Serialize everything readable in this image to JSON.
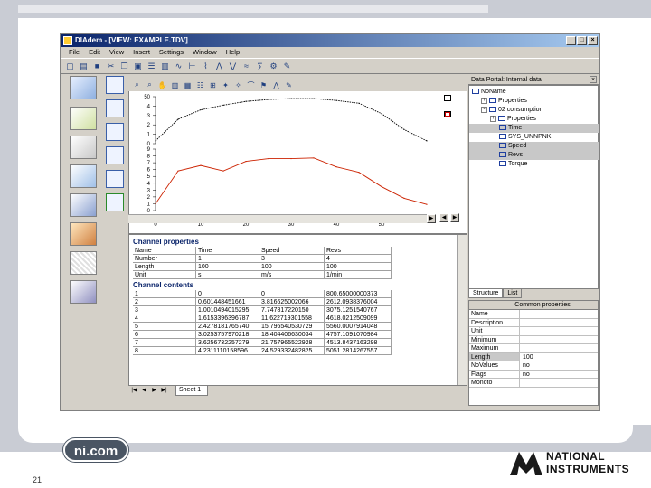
{
  "slide": {
    "logo_text": "ni.com",
    "slide_number": "21",
    "brand_line1": "NATIONAL",
    "brand_line2": "INSTRUMENTS"
  },
  "window": {
    "title": "DIAdem - [VIEW: EXAMPLE.TDV]",
    "menu": [
      "File",
      "Edit",
      "View",
      "Insert",
      "Settings",
      "Window",
      "Help"
    ],
    "min_label": "_",
    "max_label": "□",
    "close_label": "×"
  },
  "chart_data": {
    "type": "line",
    "x": [
      0,
      5,
      10,
      15,
      20,
      25,
      30,
      35,
      40,
      45,
      50,
      55,
      60
    ],
    "xticks": [
      "0",
      "10",
      "20",
      "30",
      "40",
      "50"
    ],
    "xlim": [
      0,
      60
    ],
    "upper": {
      "yticks": [
        "0",
        "1",
        "2",
        "3",
        "4",
        "50"
      ],
      "ylim": [
        0,
        5
      ],
      "series": [
        {
          "color": "#000000",
          "style": "dashed",
          "values": [
            0.3,
            2.6,
            3.6,
            4.1,
            4.5,
            4.7,
            4.8,
            4.8,
            4.6,
            4.3,
            3.2,
            1.5,
            0.3
          ]
        }
      ]
    },
    "lower": {
      "yticks": [
        "0",
        "1",
        "2",
        "3",
        "4",
        "5",
        "6",
        "7",
        "8",
        "9"
      ],
      "ylim": [
        0,
        9
      ],
      "series": [
        {
          "color": "#cc2200",
          "style": "solid",
          "values": [
            1.0,
            5.8,
            6.6,
            5.8,
            7.2,
            7.6,
            7.6,
            7.7,
            6.4,
            5.6,
            3.5,
            1.8,
            0.9
          ]
        }
      ]
    }
  },
  "portal": {
    "title": "Data Portal: Internal data",
    "close_label": "×",
    "tree": [
      {
        "label": "NoName",
        "indent": 0,
        "expander": "",
        "selected": false
      },
      {
        "label": "Properties",
        "indent": 1,
        "expander": "+",
        "selected": false
      },
      {
        "label": "02 consumption",
        "indent": 1,
        "expander": "-",
        "selected": false
      },
      {
        "label": "Properties",
        "indent": 2,
        "expander": "+",
        "selected": false
      },
      {
        "label": "Time",
        "indent": 3,
        "expander": "",
        "selected": true
      },
      {
        "label": "SYS_UNNPNK",
        "indent": 3,
        "expander": "",
        "selected": false
      },
      {
        "label": "Speed",
        "indent": 3,
        "expander": "",
        "selected": true
      },
      {
        "label": "Revs",
        "indent": 3,
        "expander": "",
        "selected": true
      },
      {
        "label": "Torque",
        "indent": 3,
        "expander": "",
        "selected": false
      }
    ],
    "tabs": [
      "Structure",
      "List"
    ],
    "props_header": "Common properties",
    "props": [
      {
        "k": "Name",
        "v": "",
        "sel": false
      },
      {
        "k": "Description",
        "v": "",
        "sel": false
      },
      {
        "k": "Unit",
        "v": "",
        "sel": false
      },
      {
        "k": "Minimum",
        "v": "",
        "sel": false
      },
      {
        "k": "Maximum",
        "v": "",
        "sel": false
      },
      {
        "k": "Length",
        "v": "100",
        "sel": true
      },
      {
        "k": "NoValues",
        "v": "no",
        "sel": false
      },
      {
        "k": "Flags",
        "v": "no",
        "sel": false
      },
      {
        "k": "Monoto",
        "v": "",
        "sel": false
      }
    ]
  },
  "sheet": {
    "section1": "Channel properties",
    "props_rows": [
      [
        "Name",
        "Time",
        "Speed",
        "Revs"
      ],
      [
        "Number",
        "1",
        "3",
        "4"
      ],
      [
        "Length",
        "100",
        "100",
        "100"
      ],
      [
        "Unit",
        "s",
        "m/s",
        "1/min"
      ]
    ],
    "section2": "Channel contents",
    "data_rows": [
      [
        "1",
        "0",
        "0",
        "800.65000000373"
      ],
      [
        "2",
        "0.601448451661",
        "3.816625002066",
        "2612.0938376004"
      ],
      [
        "3",
        "1.0010494015295",
        "7.747817220150",
        "3075.1251540767"
      ],
      [
        "4",
        "1.6153396396787",
        "11.622719301558",
        "4618.0212509099"
      ],
      [
        "5",
        "2.4278181765740",
        "15.796540530729",
        "5560.0007914048"
      ],
      [
        "6",
        "3.0253757970218",
        "18.404406630034",
        "4757.1091070984"
      ],
      [
        "7",
        "3.6256732257279",
        "21.757965522928",
        "4513.8437163298"
      ],
      [
        "8",
        "4.2311110158596",
        "24.529332482825",
        "5051.2814267557"
      ]
    ],
    "tab_label": "Sheet 1"
  }
}
